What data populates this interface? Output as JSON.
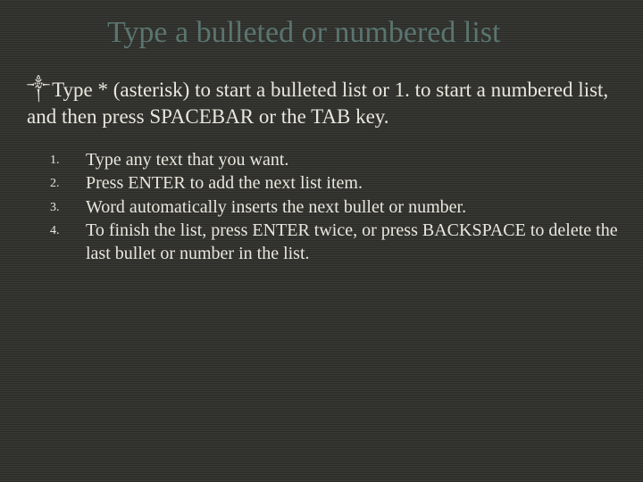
{
  "title": "Type a bulleted or numbered list",
  "intro_bullet": "༒",
  "intro": "Type * (asterisk) to start a bulleted list or 1. to start a numbered list, and then press SPACEBAR or the TAB key.",
  "steps": [
    "Type any text that you want.",
    "Press ENTER to add the next list item.",
    "Word automatically inserts the next bullet or number.",
    "To finish the list, press ENTER twice, or press BACKSPACE to delete the last bullet or number in the list."
  ]
}
